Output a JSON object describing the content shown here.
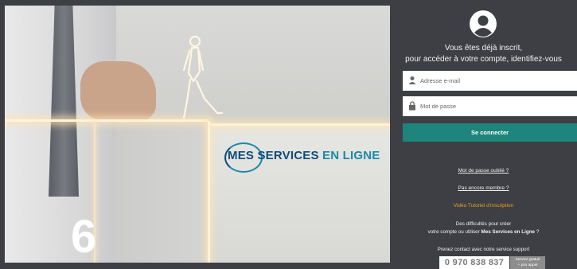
{
  "hero": {
    "logo_word_main": "MES SERVICES",
    "logo_word_sub": " EN LIGNE",
    "step_number": "6"
  },
  "login": {
    "user_icon": "user-avatar-icon",
    "intro_line1": "Vous êtes déjà inscrit,",
    "intro_line2": "pour accéder à votre compte, identifiez-vous",
    "email_placeholder": "Adresse e-mail",
    "password_placeholder": "Mot de passe",
    "submit_label": "Se connecter",
    "forgot_label": "Mot de passe oublié ?",
    "not_member_label": "Pas encore membre ?",
    "video_label": "Vidéo Tutoriel d'inscription",
    "help_line1": "Des difficultés pour créer",
    "help_line2_prefix": "votre compte ou utiliser ",
    "help_line2_bold": "Mes Services en Ligne",
    "help_line2_suffix": " ?",
    "support_label": "Prenez contact avec notre service support",
    "phone_number": "0 970 838 837",
    "phone_tag_line1": "Service gratuit",
    "phone_tag_line2": "+ prix appel"
  },
  "colors": {
    "panel_bg": "#3e3f44",
    "button": "#1e857c",
    "video_link": "#e8a025"
  }
}
